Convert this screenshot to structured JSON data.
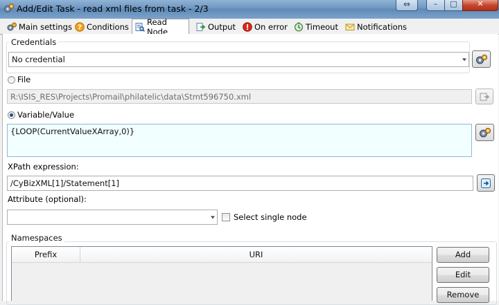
{
  "window": {
    "title": "Add/Edit Task - read xml files from task - 2/3",
    "swap_glyph": "⇔",
    "min_glyph": "–",
    "max_glyph": "□",
    "close_glyph": "✕"
  },
  "tabs": [
    {
      "label": "Main settings",
      "icon": "gears-icon",
      "active": false
    },
    {
      "label": "Conditions",
      "icon": "question-icon",
      "active": false
    },
    {
      "label": "Read Node",
      "icon": "read-node-icon",
      "active": true
    },
    {
      "label": "Output",
      "icon": "output-icon",
      "active": false
    },
    {
      "label": "On error",
      "icon": "error-icon",
      "active": false
    },
    {
      "label": "Timeout",
      "icon": "timeout-icon",
      "active": false
    },
    {
      "label": "Notifications",
      "icon": "envelope-icon",
      "active": false
    }
  ],
  "credentials": {
    "group_label": "Credentials",
    "value": "No credential"
  },
  "file": {
    "label": "File",
    "selected": false,
    "value": "R:\\ISIS_RES\\Projects\\Promail\\philatelic\\data\\Stmt596750.xml"
  },
  "variable": {
    "label": "Variable/Value",
    "selected": true,
    "value": "{LOOP(CurrentValueXArray,0)}"
  },
  "xpath": {
    "label": "XPath expression:",
    "value": "/CyBizXML[1]/Statement[1]"
  },
  "attribute": {
    "label": "Attribute (optional):",
    "value": "",
    "select_single_label": "Select single node",
    "select_single_checked": false
  },
  "namespaces": {
    "group_label": "Namespaces",
    "columns": [
      "Prefix",
      "URI"
    ],
    "rows": [],
    "add_label": "Add",
    "edit_label": "Edit",
    "remove_label": "Remove"
  },
  "colors": {
    "titlebar": "#6e96c1",
    "variable_bg": "#f1ffff",
    "accent": "#1c4f8a"
  }
}
